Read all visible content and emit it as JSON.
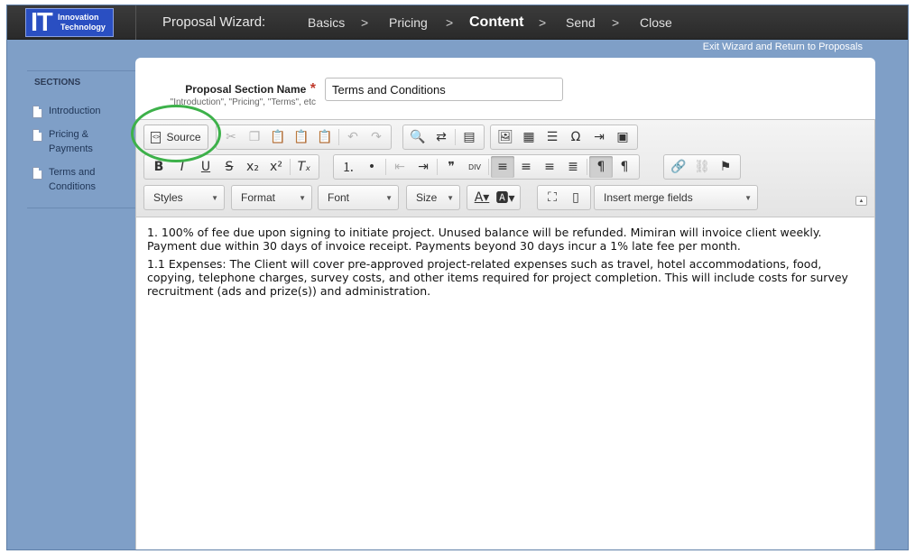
{
  "logo": {
    "big": "IT",
    "line1": "Innovation",
    "line2": "Technology"
  },
  "wizard": {
    "title": "Proposal Wizard:",
    "steps": [
      "Basics",
      "Pricing",
      "Content",
      "Send",
      "Close"
    ],
    "current_step": "Content",
    "separator": ">",
    "exit_link": "Exit Wizard and Return to Proposals"
  },
  "sidebar": {
    "heading": "SECTIONS",
    "items": [
      {
        "label": "Introduction"
      },
      {
        "label": "Pricing & Payments"
      },
      {
        "label": "Terms and Conditions"
      }
    ]
  },
  "form": {
    "name_label": "Proposal Section Name",
    "required_mark": "*",
    "hint": "\"Introduction\", \"Pricing\", \"Terms\", etc",
    "name_value": "Terms and Conditions"
  },
  "toolbar": {
    "source_label": "Source",
    "combos": {
      "styles": "Styles",
      "format": "Format",
      "font": "Font",
      "size": "Size",
      "merge": "Insert merge fields"
    }
  },
  "content": {
    "paragraphs": [
      "1. 100% of fee due upon signing to initiate project.  Unused balance will be refunded.  Mimiran will invoice client weekly.  Payment due within 30 days of invoice receipt. Payments beyond 30 days incur a 1% late fee per month.",
      "1.1 Expenses:  The Client will cover pre-approved project-related expenses such as travel, hotel accommodations, food, copying, telephone charges, survey costs, and other items required for project completion.  This will include costs for survey recruitment (ads and prize(s)) and administration."
    ]
  },
  "colors": {
    "background": "#7f9fc7",
    "topbar": "#2e2e2e",
    "highlight": "#3db14a",
    "logo": "#2a4fc2"
  }
}
